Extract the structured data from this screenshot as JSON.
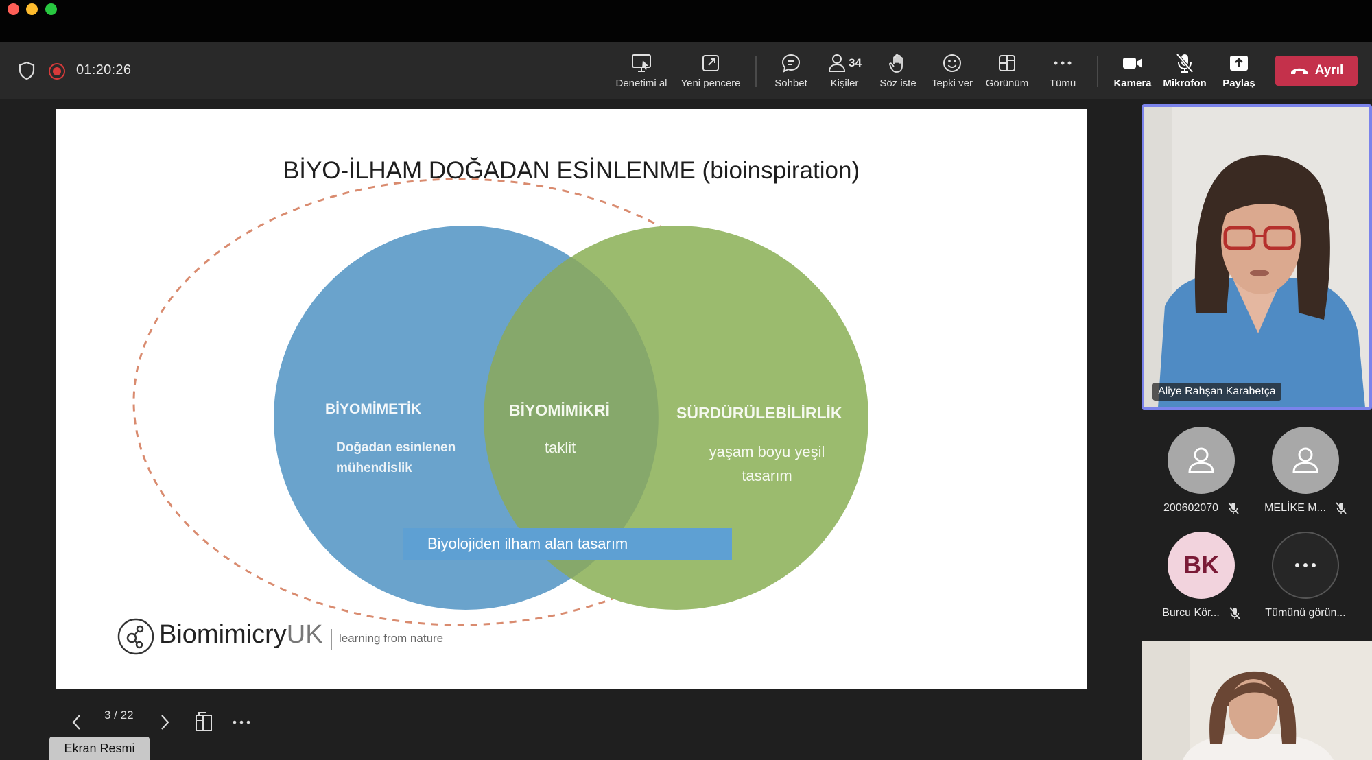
{
  "timer": "01:20:26",
  "toolbar": {
    "take_control": "Denetimi al",
    "new_window": "Yeni pencere",
    "chat": "Sohbet",
    "people": "Kişiler",
    "people_count": "34",
    "raise_hand": "Söz iste",
    "react": "Tepki ver",
    "view": "Görünüm",
    "more": "Tümü",
    "camera": "Kamera",
    "mic": "Mikrofon",
    "share": "Paylaş",
    "leave": "Ayrıl"
  },
  "slide": {
    "title": "BİYO-İLHAM DOĞADAN ESİNLENME (bioinspiration)",
    "left_heading": "BİYOMİMETİK",
    "left_text_1": "Doğadan esinlenen",
    "left_text_2": "mühendislik",
    "center_heading": "BİYOMİMİKRİ",
    "center_text": "taklit",
    "right_heading": "SÜRDÜRÜLEBİLİRLİK",
    "right_text_1": "yaşam boyu yeşil",
    "right_text_2": "tasarım",
    "banner": "Biyolojiden ilham alan tasarım",
    "logo_name": "Biomimicry",
    "logo_suffix": "UK",
    "logo_tagline": "learning from nature"
  },
  "slide_nav": {
    "pager": "3 / 22"
  },
  "screenshot_label": "Ekran Resmi",
  "participants": {
    "main_speaker": "Aliye Rahşan Karabetça",
    "p1": "200602070",
    "p2": "MELİKE M...",
    "p3": "Burcu Kör...",
    "p3_initials": "BK",
    "see_all": "Tümünü görün..."
  },
  "colors": {
    "leave_red": "#c4314b",
    "active_speaker_border": "#7b83eb",
    "venn_blue": "#6aa3cc",
    "venn_green": "#9bbb6e",
    "venn_overlap": "#86a86b",
    "banner_blue": "#5ea0d3"
  }
}
